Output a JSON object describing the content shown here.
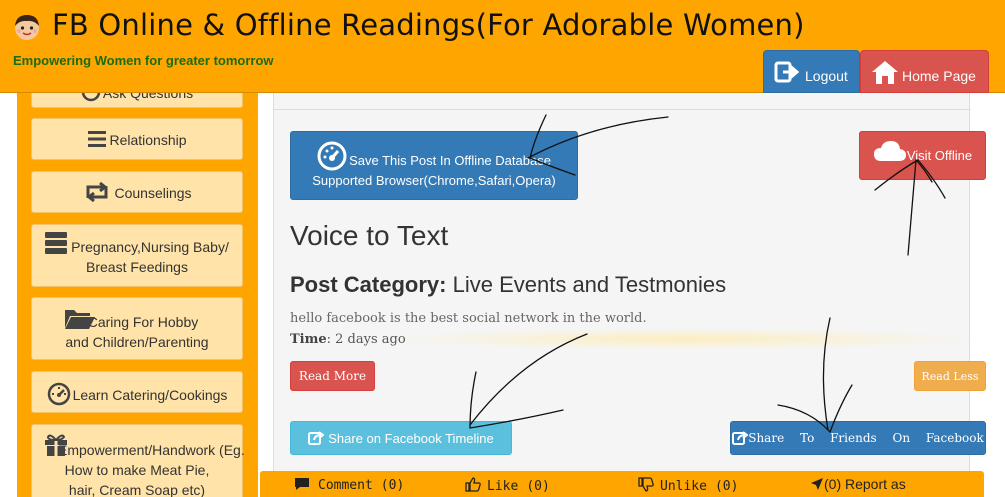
{
  "header": {
    "title": "FB Online & Offline Readings(For Adorable Women)",
    "subtitle": "Empowering Women for greater tomorrow",
    "logout_label": "Logout",
    "home_label": "Home Page"
  },
  "sidebar": {
    "items": [
      {
        "label": "Ask Questions",
        "icon": "question-circle-icon"
      },
      {
        "label": "Relationship",
        "icon": "list-icon"
      },
      {
        "label": "Counselings",
        "icon": "retweet-icon"
      },
      {
        "label_line1": "Pregnancy,Nursing Baby/",
        "label_line2": "Breast Feedings",
        "icon": "server-stack-icon"
      },
      {
        "label_line1": "Caring For Hobby",
        "label_line2": "and Children/Parenting",
        "icon": "folder-open-icon"
      },
      {
        "label": "Learn Catering/Cookings",
        "icon": "dashboard-icon"
      },
      {
        "label_line1": "Empowerment/Handwork (Eg.",
        "label_line2": "How to make Meat Pie,",
        "label_line3": "hair, Cream Soap etc)",
        "icon": "gift-icon"
      }
    ]
  },
  "post": {
    "save_line1": "Save This Post In Offline Database",
    "save_line2": "Supported Browser(Chrome,Safari,Opera)",
    "visit_offline": "Visit Offline",
    "title": "Voice to Text",
    "category_label": "Post Category:",
    "category_value": "Live Events and Testmonies",
    "body": "hello facebook is the best social network in the world.",
    "time_label": "Time",
    "time_value": ": 2 days ago",
    "read_more": "Read More",
    "read_less": "Read Less",
    "share_timeline": "Share on Facebook Timeline",
    "share_friends": "Share To Friends On Facebook"
  },
  "actions": {
    "comment_label": "Comment",
    "comment_count": "(0)",
    "like_label": "Like",
    "like_count": "(0)",
    "unlike_label": "Unlike",
    "unlike_count": "(0)",
    "report_label": "(0) Report as"
  },
  "colors": {
    "brand_orange": "#FFA500",
    "sidebar_item_bg": "#FFE3A8",
    "primary_blue": "#337ab7",
    "danger_red": "#d9534f",
    "info_cyan": "#5bc0de",
    "warning_orange": "#f0ad4e",
    "subtitle_green": "#1d6b12"
  }
}
